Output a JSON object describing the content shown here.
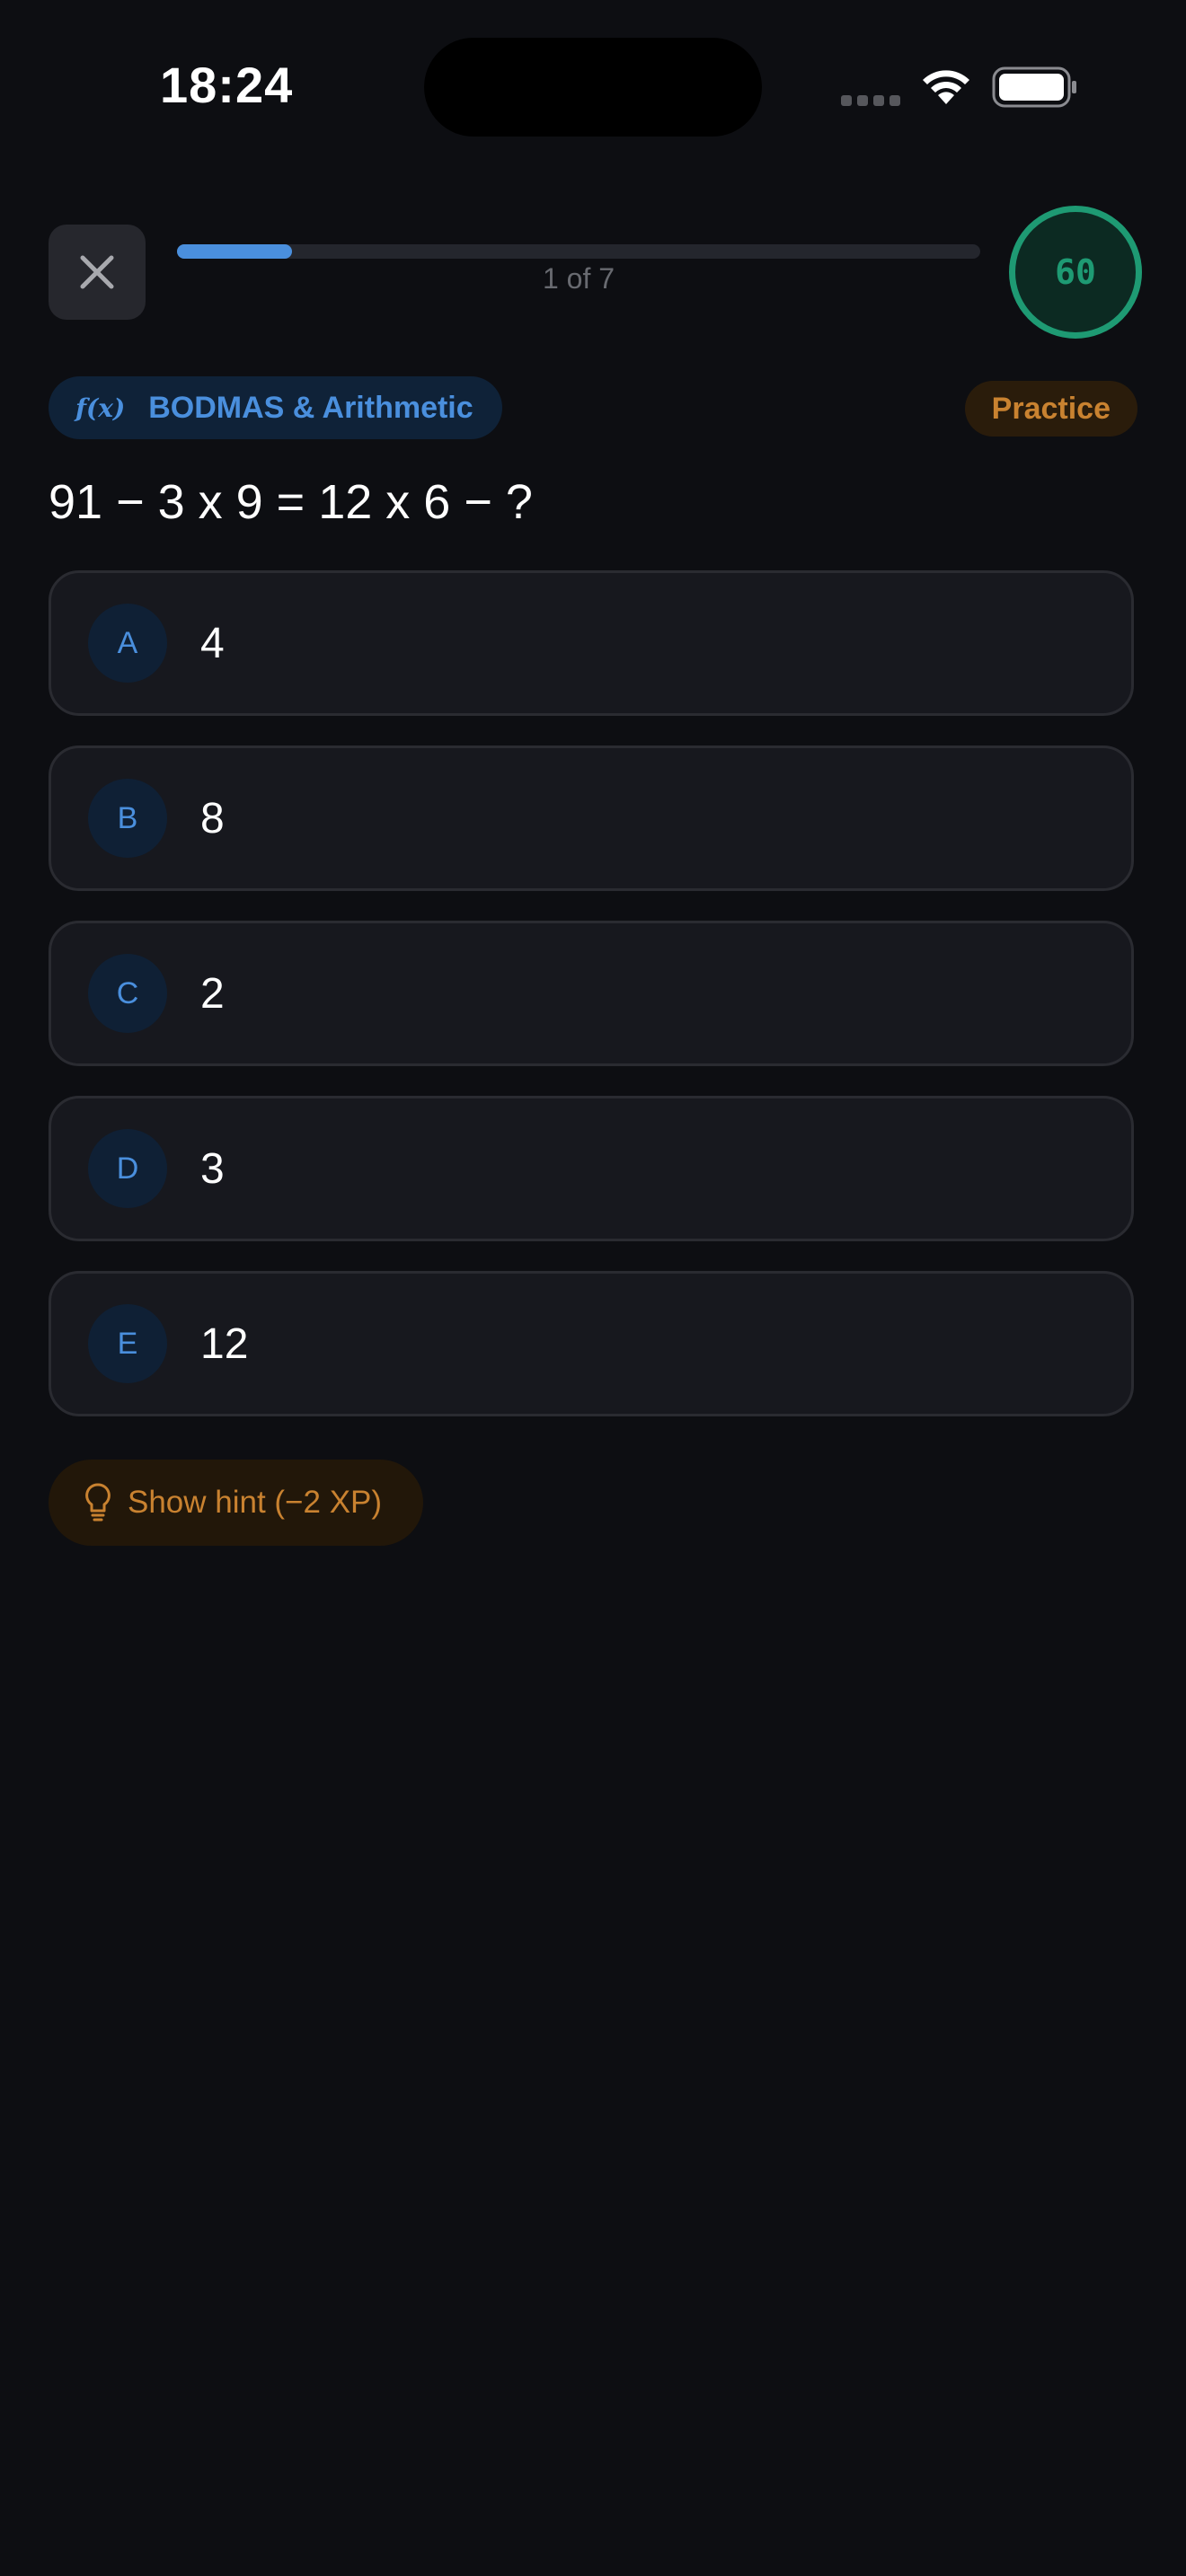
{
  "status_bar": {
    "time": "18:24"
  },
  "header": {
    "progress_text": "1 of 7",
    "progress_fraction": 0.143,
    "score": "60"
  },
  "topic": {
    "label": "BODMAS & Arithmetic",
    "icon_text": "f(x)"
  },
  "mode_badge": "Practice",
  "question": "91 − 3 x 9 = 12 x 6 − ?",
  "options": [
    {
      "letter": "A",
      "value": "4"
    },
    {
      "letter": "B",
      "value": "8"
    },
    {
      "letter": "C",
      "value": "2"
    },
    {
      "letter": "D",
      "value": "3"
    },
    {
      "letter": "E",
      "value": "12"
    }
  ],
  "hint_button": "Show hint (−2 XP)",
  "colors": {
    "background": "#0d0e12",
    "accent_blue": "#4a8fdd",
    "score_green": "#1e9a73",
    "hint_orange": "#c98230"
  }
}
